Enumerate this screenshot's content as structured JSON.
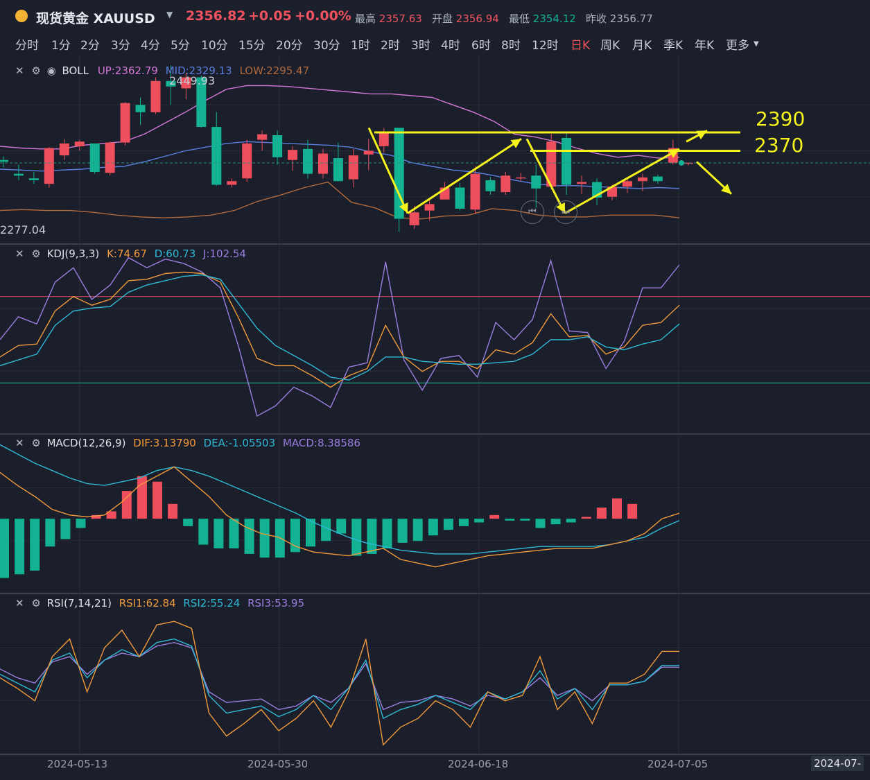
{
  "header": {
    "symbol": "现货黄金 XAUUSD",
    "price": "2356.82",
    "change": "+0.05",
    "change_pct": "+0.00%",
    "stats": [
      {
        "label": "最高",
        "value": "2357.63"
      },
      {
        "label": "开盘",
        "value": "2356.94"
      },
      {
        "label": "最低",
        "value": "2354.12"
      },
      {
        "label": "昨收",
        "value": "2356.77"
      }
    ]
  },
  "timeframes": [
    "分时",
    "1分",
    "2分",
    "3分",
    "4分",
    "5分",
    "10分",
    "15分",
    "20分",
    "30分",
    "1时",
    "2时",
    "3时",
    "4时",
    "6时",
    "8时",
    "12时",
    "日K",
    "周K",
    "月K",
    "季K",
    "年K",
    "更多"
  ],
  "active_timeframe": "日K",
  "colors": {
    "up": "#ef4f5c",
    "down": "#12b293",
    "boll_up": "#d478d6",
    "boll_mid": "#5b7fe0",
    "boll_low": "#b36a3c",
    "k": "#f29a3c",
    "d": "#30b9d6",
    "j": "#9c7ee0",
    "annot": "#f5f21c"
  },
  "panels": {
    "boll": {
      "name": "BOLL",
      "up": "UP:2362.79",
      "mid": "MID:2329.13",
      "low": "LOW:2295.47",
      "high_label": "2449.93",
      "low_label": "2277.04"
    },
    "kdj": {
      "name": "KDJ(9,3,3)",
      "k": "K:74.67",
      "d": "D:60.73",
      "j": "J:102.54"
    },
    "macd": {
      "name": "MACD(12,26,9)",
      "dif": "DIF:3.13790",
      "dea": "DEA:-1.05503",
      "macd": "MACD:8.38586"
    },
    "rsi": {
      "name": "RSI(7,14,21)",
      "rsi1": "RSI1:62.84",
      "rsi2": "RSI2:55.24",
      "rsi3": "RSI3:53.95"
    }
  },
  "annotations": {
    "level1": "2390",
    "level2": "2370"
  },
  "x_dates": [
    "2024-05-13",
    "2024-05-30",
    "2024-06-18",
    "2024-07-05",
    "2024-07-"
  ],
  "chart_data": {
    "type": "candlestick",
    "candles": [
      [
        2360,
        2364,
        2352,
        2358
      ],
      [
        2345,
        2355,
        2338,
        2343
      ],
      [
        2340,
        2347,
        2334,
        2338
      ],
      [
        2334,
        2374,
        2330,
        2373
      ],
      [
        2365,
        2383,
        2360,
        2378
      ],
      [
        2375,
        2382,
        2370,
        2380
      ],
      [
        2378,
        2350,
        2345,
        2347
      ],
      [
        2346,
        2380,
        2343,
        2379
      ],
      [
        2379,
        2423,
        2376,
        2422
      ],
      [
        2420,
        2428,
        2398,
        2412
      ],
      [
        2412,
        2450,
        2410,
        2446
      ],
      [
        2446,
        2463,
        2420,
        2440
      ],
      [
        2438,
        2455,
        2426,
        2450
      ],
      [
        2450,
        2452,
        2395,
        2396
      ],
      [
        2396,
        2412,
        2332,
        2333
      ],
      [
        2333,
        2340,
        2330,
        2337
      ],
      [
        2340,
        2382,
        2336,
        2378
      ],
      [
        2382,
        2392,
        2370,
        2388
      ],
      [
        2387,
        2392,
        2355,
        2363
      ],
      [
        2360,
        2375,
        2348,
        2371
      ],
      [
        2372,
        2382,
        2340,
        2345
      ],
      [
        2345,
        2372,
        2340,
        2367
      ],
      [
        2362,
        2379,
        2338,
        2337
      ],
      [
        2339,
        2372,
        2330,
        2365
      ],
      [
        2366,
        2383,
        2349,
        2370
      ],
      [
        2375,
        2395,
        2368,
        2390
      ],
      [
        2395,
        2395,
        2282,
        2296
      ],
      [
        2289,
        2310,
        2285,
        2303
      ],
      [
        2305,
        2316,
        2294,
        2312
      ],
      [
        2317,
        2336,
        2318,
        2330
      ],
      [
        2330,
        2335,
        2305,
        2307
      ],
      [
        2306,
        2353,
        2301,
        2345
      ],
      [
        2338,
        2342,
        2322,
        2326
      ],
      [
        2325,
        2347,
        2322,
        2343
      ],
      [
        2340,
        2346,
        2337,
        2341
      ],
      [
        2343,
        2355,
        2308,
        2329
      ],
      [
        2331,
        2388,
        2328,
        2380
      ],
      [
        2384,
        2389,
        2322,
        2333
      ],
      [
        2334,
        2343,
        2323,
        2336
      ],
      [
        2336,
        2340,
        2311,
        2319
      ],
      [
        2320,
        2333,
        2316,
        2331
      ],
      [
        2331,
        2340,
        2324,
        2337
      ],
      [
        2337,
        2345,
        2326,
        2341
      ],
      [
        2342,
        2344,
        2334,
        2337
      ],
      [
        2357,
        2382,
        2355,
        2373
      ],
      [
        2356,
        2357,
        2354,
        2357
      ]
    ],
    "boll_up": [
      2375,
      2373,
      2372,
      2372,
      2376,
      2378,
      2380,
      2388,
      2400,
      2412,
      2425,
      2437,
      2441,
      2441,
      2440,
      2438,
      2436,
      2434,
      2432,
      2432,
      2430,
      2428,
      2420,
      2412,
      2402,
      2388,
      2385,
      2380,
      2373,
      2367,
      2363,
      2365,
      2362,
      2363
    ],
    "boll_mid": [
      2350,
      2349,
      2348,
      2349,
      2350,
      2352,
      2353,
      2358,
      2364,
      2370,
      2374,
      2378,
      2380,
      2379,
      2378,
      2377,
      2376,
      2374,
      2369,
      2365,
      2357,
      2353,
      2349,
      2347,
      2343,
      2338,
      2334,
      2332,
      2332,
      2331,
      2330,
      2329,
      2330,
      2329
    ],
    "boll_low": [
      2305,
      2306,
      2305,
      2305,
      2303,
      2300,
      2298,
      2297,
      2298,
      2300,
      2305,
      2315,
      2322,
      2330,
      2336,
      2314,
      2308,
      2297,
      2296,
      2299,
      2300,
      2307,
      2305,
      2300,
      2298,
      2298,
      2300,
      2300,
      2300,
      2297
    ],
    "kdj_k": [
      38,
      46,
      47,
      70,
      80,
      74,
      78,
      91,
      92,
      96,
      97,
      96,
      90,
      65,
      37,
      32,
      32,
      25,
      17,
      25,
      30,
      60,
      38,
      28,
      35,
      35,
      30,
      43,
      40,
      48,
      68,
      52,
      53,
      40,
      45,
      60,
      62,
      74
    ],
    "kdj_d": [
      32,
      36,
      40,
      60,
      70,
      72,
      73,
      83,
      88,
      91,
      94,
      95,
      92,
      75,
      58,
      46,
      39,
      32,
      24,
      22,
      28,
      38,
      38,
      35,
      34,
      33,
      33,
      34,
      35,
      40,
      50,
      50,
      52,
      45,
      43,
      47,
      50,
      61
    ],
    "kdj_j": [
      50,
      66,
      61,
      90,
      100,
      78,
      88,
      107,
      100,
      106,
      103,
      97,
      86,
      45,
      -3,
      4,
      17,
      11,
      3,
      31,
      34,
      104,
      36,
      15,
      37,
      39,
      24,
      62,
      50,
      64,
      105,
      56,
      55,
      30,
      49,
      86,
      86,
      102
    ],
    "macd_hist": [
      -32,
      -30,
      -28,
      -15,
      -11,
      -5,
      2,
      4,
      15,
      23,
      20,
      8,
      -4,
      -14,
      -16,
      -16,
      -19,
      -21,
      -21,
      -18,
      -15,
      -12,
      -8,
      -20,
      -19,
      -16,
      -13,
      -12,
      -9,
      -6,
      -4,
      -2,
      2,
      -1,
      -1,
      -5,
      -3,
      -2,
      1,
      6,
      11,
      8
    ],
    "macd_dif": [
      25,
      18,
      12,
      5,
      2,
      1,
      2,
      9,
      18,
      23,
      28,
      20,
      12,
      2,
      -4,
      -8,
      -10,
      -15,
      -18,
      -19,
      -20,
      -18,
      -16,
      -22,
      -24,
      -26,
      -24,
      -22,
      -20,
      -19,
      -18,
      -17,
      -16,
      -16,
      -16,
      -14,
      -12,
      -8,
      0,
      3
    ],
    "macd_dea": [
      40,
      35,
      30,
      26,
      22,
      19,
      18,
      20,
      22,
      26,
      28,
      26,
      23,
      19,
      15,
      11,
      7,
      3,
      -2,
      -6,
      -10,
      -13,
      -15,
      -17,
      -18,
      -19,
      -19,
      -19,
      -18,
      -17,
      -16,
      -15,
      -15,
      -15,
      -15,
      -14,
      -12,
      -10,
      -5,
      -1
    ],
    "rsi1": [
      48,
      42,
      35,
      60,
      70,
      40,
      65,
      75,
      60,
      78,
      80,
      76,
      28,
      15,
      22,
      30,
      18,
      25,
      35,
      20,
      40,
      70,
      10,
      20,
      25,
      35,
      30,
      20,
      40,
      35,
      38,
      60,
      30,
      40,
      22,
      45,
      45,
      50,
      63,
      63
    ],
    "rsi2": [
      50,
      45,
      40,
      58,
      62,
      48,
      58,
      64,
      60,
      68,
      70,
      66,
      38,
      28,
      30,
      32,
      26,
      30,
      38,
      30,
      42,
      58,
      25,
      30,
      33,
      38,
      34,
      30,
      40,
      36,
      40,
      52,
      36,
      42,
      30,
      44,
      44,
      46,
      55,
      55
    ],
    "rsi3": [
      53,
      48,
      45,
      57,
      60,
      50,
      58,
      62,
      60,
      66,
      68,
      65,
      40,
      34,
      35,
      36,
      30,
      32,
      38,
      34,
      42,
      56,
      30,
      34,
      35,
      38,
      36,
      32,
      38,
      36,
      40,
      48,
      38,
      42,
      35,
      44,
      44,
      46,
      54,
      54
    ]
  }
}
